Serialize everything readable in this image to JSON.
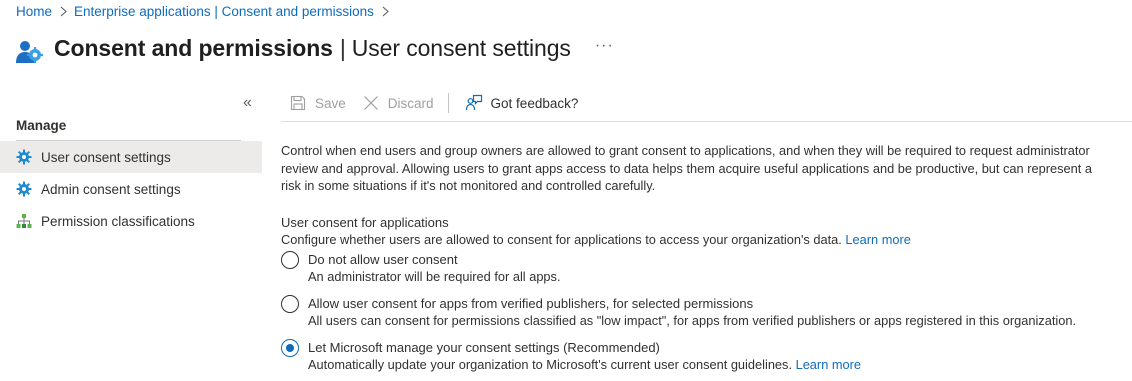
{
  "breadcrumb": {
    "items": [
      {
        "label": "Home"
      },
      {
        "label": "Enterprise applications | Consent and permissions"
      }
    ]
  },
  "header": {
    "title_main": "Consent and permissions",
    "title_pipe": "|",
    "title_sub": "User consent settings",
    "more_label": "···",
    "icon": "enterprise-apps-icon"
  },
  "sidebar": {
    "collapse_label": "«",
    "heading": "Manage",
    "items": [
      {
        "label": "User consent settings",
        "icon": "gear-icon",
        "active": true
      },
      {
        "label": "Admin consent settings",
        "icon": "gear-icon",
        "active": false
      },
      {
        "label": "Permission classifications",
        "icon": "hierarchy-icon",
        "active": false
      }
    ]
  },
  "toolbar": {
    "save_label": "Save",
    "discard_label": "Discard",
    "feedback_label": "Got feedback?"
  },
  "content": {
    "description": "Control when end users and group owners are allowed to grant consent to applications, and when they will be required to request administrator review and approval. Allowing users to grant apps access to data helps them acquire useful applications and be productive, but can represent a risk in some situations if it's not monitored and controlled carefully.",
    "section_title": "User consent for applications",
    "section_desc": "Configure whether users are allowed to consent for applications to access your organization's data.",
    "learn_more": "Learn more",
    "options": [
      {
        "label": "Do not allow user consent",
        "desc": "An administrator will be required for all apps.",
        "checked": false
      },
      {
        "label": "Allow user consent for apps from verified publishers, for selected permissions",
        "desc": "All users can consent for permissions classified as \"low impact\", for apps from verified publishers or apps registered in this organization.",
        "checked": false
      },
      {
        "label": "Let Microsoft manage your consent settings (Recommended)",
        "desc": "Automatically update your organization to Microsoft's current user consent guidelines.",
        "checked": true,
        "learn_more": "Learn more"
      }
    ]
  },
  "colors": {
    "accent": "#0f6cbd",
    "text": "#323130",
    "disabled": "#a19f9d",
    "active_nav_bg": "#edebe9",
    "gear_icon": "#1f8ad2",
    "hierarchy_icon": "#5eb44c"
  }
}
